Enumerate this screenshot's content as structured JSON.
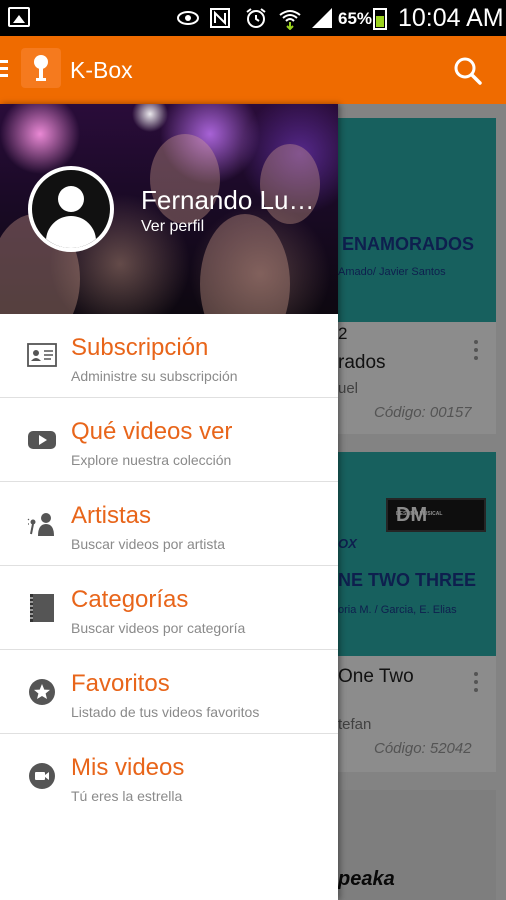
{
  "status_bar": {
    "battery": "65%",
    "time": "10:04 AM"
  },
  "app_bar": {
    "title": "K-Box",
    "icons": [
      "menu-icon",
      "kbox-logo",
      "search-icon"
    ]
  },
  "drawer": {
    "user_name": "Fernando Lu…",
    "profile_link": "Ver perfil",
    "items": [
      {
        "title": "Subscripción",
        "subtitle": "Administre su subscripción",
        "icon": "id-card-icon"
      },
      {
        "title": "Qué videos ver",
        "subtitle": "Explore nuestra colección",
        "icon": "play-icon"
      },
      {
        "title": "Artistas",
        "subtitle": "Buscar videos por artista",
        "icon": "singer-icon"
      },
      {
        "title": "Categorías",
        "subtitle": "Buscar videos por categoría",
        "icon": "book-icon"
      },
      {
        "title": "Favoritos",
        "subtitle": "Listado de tus videos favoritos",
        "icon": "star-icon"
      },
      {
        "title": "Mis videos",
        "subtitle": "Tú eres la estrella",
        "icon": "video-camera-icon"
      }
    ]
  },
  "background_cards": [
    {
      "thumb_title": "ENAMORADOS",
      "thumb_sub": "Amado/ Javier Santos",
      "song": "rados",
      "song_prefix": "2",
      "artist": "uel",
      "code": "Código: 00157"
    },
    {
      "thumb_title": "NE TWO THREE",
      "thumb_sub": "oria M. / Garcia, E. Elias",
      "brand": "DM",
      "brand_small": "DESTINO MUSICAL",
      "brand_partial": "OX",
      "song": "One Two",
      "artist": "tefan",
      "code": "Código: 52042"
    },
    {
      "partial_text": "peaka"
    }
  ],
  "colors": {
    "accent": "#ef6b00",
    "menu_title": "#e8651a",
    "icon": "#555555"
  }
}
